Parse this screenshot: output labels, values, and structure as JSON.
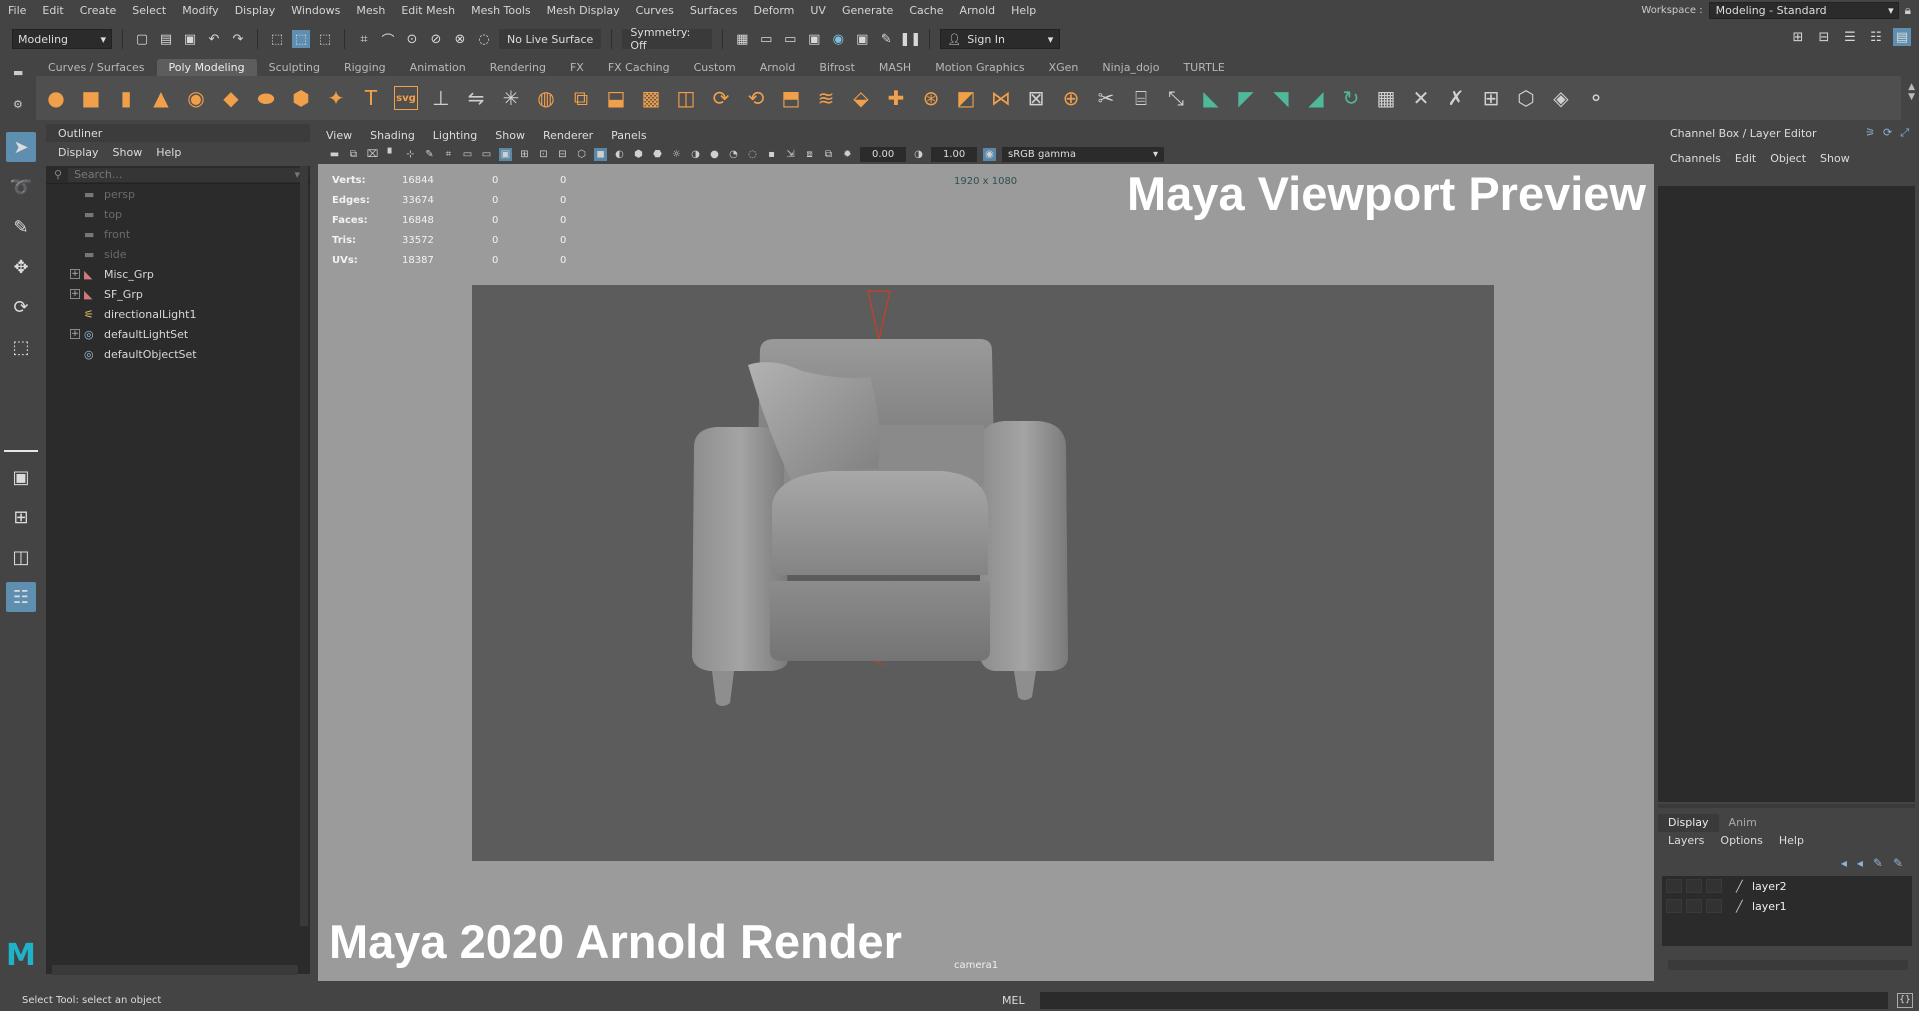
{
  "menubar": {
    "items": [
      "File",
      "Edit",
      "Create",
      "Select",
      "Modify",
      "Display",
      "Windows",
      "Mesh",
      "Edit Mesh",
      "Mesh Tools",
      "Mesh Display",
      "Curves",
      "Surfaces",
      "Deform",
      "UV",
      "Generate",
      "Cache",
      "Arnold",
      "Help"
    ],
    "workspace_label": "Workspace :",
    "workspace_value": "Modeling - Standard"
  },
  "statusline": {
    "mode": "Modeling",
    "live_surface": "No Live Surface",
    "symmetry": "Symmetry: Off",
    "sign_in": "Sign In"
  },
  "shelf": {
    "tabs": [
      "Curves / Surfaces",
      "Poly Modeling",
      "Sculpting",
      "Rigging",
      "Animation",
      "Rendering",
      "FX",
      "FX Caching",
      "Custom",
      "Arnold",
      "Bifrost",
      "MASH",
      "Motion Graphics",
      "XGen",
      "Ninja_dojo",
      "TURTLE"
    ],
    "active_tab": "Poly Modeling"
  },
  "outliner": {
    "title": "Outliner",
    "menu": [
      "Display",
      "Show",
      "Help"
    ],
    "search_placeholder": "Search...",
    "items": [
      {
        "label": "persp",
        "icon": "camera-icon",
        "dim": true,
        "expand": false
      },
      {
        "label": "top",
        "icon": "camera-icon",
        "dim": true,
        "expand": false
      },
      {
        "label": "front",
        "icon": "camera-icon",
        "dim": true,
        "expand": false
      },
      {
        "label": "side",
        "icon": "camera-icon",
        "dim": true,
        "expand": false
      },
      {
        "label": "Misc_Grp",
        "icon": "group-icon",
        "dim": false,
        "expand": true
      },
      {
        "label": "SF_Grp",
        "icon": "group-icon",
        "dim": false,
        "expand": true
      },
      {
        "label": "directionalLight1",
        "icon": "light-icon",
        "dim": false,
        "expand": false
      },
      {
        "label": "defaultLightSet",
        "icon": "set-icon",
        "dim": false,
        "expand": true
      },
      {
        "label": "defaultObjectSet",
        "icon": "set-icon",
        "dim": false,
        "expand": false
      }
    ]
  },
  "viewport": {
    "menu": [
      "View",
      "Shading",
      "Lighting",
      "Show",
      "Renderer",
      "Panels"
    ],
    "exposure": "0.00",
    "gamma": "1.00",
    "color_space": "sRGB gamma",
    "resolution_gate": "1920 x 1080",
    "camera": "camera1",
    "hud": [
      {
        "label": "Verts:",
        "value": "16844",
        "sel": "0",
        "comp": "0"
      },
      {
        "label": "Edges:",
        "value": "33674",
        "sel": "0",
        "comp": "0"
      },
      {
        "label": "Faces:",
        "value": "16848",
        "sel": "0",
        "comp": "0"
      },
      {
        "label": "Tris:",
        "value": "33572",
        "sel": "0",
        "comp": "0"
      },
      {
        "label": "UVs:",
        "value": "18387",
        "sel": "0",
        "comp": "0"
      }
    ],
    "overlay_top": "Maya Viewport Preview",
    "overlay_bottom": "Maya 2020 Arnold Render"
  },
  "channelbox": {
    "title": "Channel Box / Layer Editor",
    "menu": [
      "Channels",
      "Edit",
      "Object",
      "Show"
    ],
    "layer_tabs": [
      "Display",
      "Anim"
    ],
    "layer_menu": [
      "Layers",
      "Options",
      "Help"
    ],
    "layers": [
      "layer2",
      "layer1"
    ]
  },
  "helpline": {
    "help_text": "Select Tool: select an object",
    "mel_label": "MEL"
  },
  "colors": {
    "accent": "#5f8fb0",
    "shelf_orange": "#f0a04a",
    "maya_logo": "#1fb3c9"
  }
}
